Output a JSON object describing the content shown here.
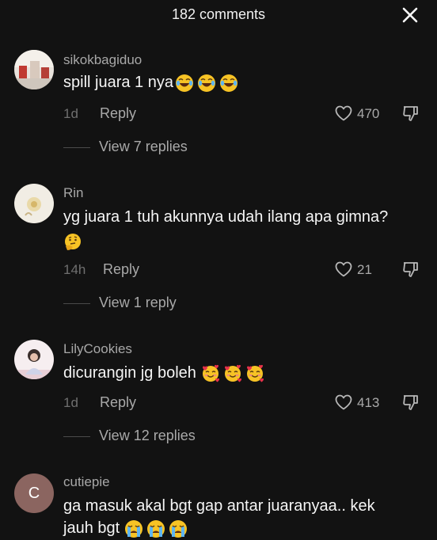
{
  "header": {
    "title": "182 comments"
  },
  "comments": [
    {
      "username": "sikokbagiduo",
      "text": "spill juara 1 nya",
      "emoji": "laughing-tears-emoji",
      "emoji_count": 3,
      "time": "1d",
      "reply_label": "Reply",
      "likes": "470",
      "view_replies": "View 7 replies"
    },
    {
      "username": "Rin",
      "text": "yg juara 1 tuh akunnya udah ilang apa gimna?",
      "emoji": "thinking-face-emoji",
      "emoji_count": 1,
      "time": "14h",
      "reply_label": "Reply",
      "likes": "21",
      "view_replies": "View 1 reply"
    },
    {
      "username": "LilyCookies",
      "text": "dicurangin jg boleh",
      "emoji": "smiling-face-with-hearts-emoji",
      "emoji_count": 3,
      "time": "1d",
      "reply_label": "Reply",
      "likes": "413",
      "view_replies": "View 12 replies"
    },
    {
      "username": "cutiepie",
      "avatar_letter": "C",
      "text_line1": "ga masuk akal bgt gap antar juaranyaa.. kek",
      "text_line2": "jauh bgt",
      "emoji": "loudly-crying-emoji",
      "emoji_count": 3
    }
  ],
  "colors": {
    "background": "#121212",
    "username": "#a8a8a8",
    "secondary": "#a9a9a9",
    "avatar_c": "#8b6560"
  }
}
